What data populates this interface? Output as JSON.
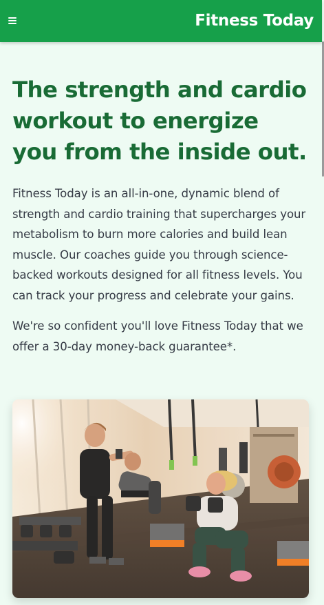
{
  "header": {
    "brand": "Fitness Today",
    "menu_icon": "hamburger-menu-icon",
    "bg_color": "#16a04a"
  },
  "hero": {
    "title": "The strength and cardio workout to energize you from the inside out.",
    "body": "Fitness Today is an all-in-one, dynamic blend of strength and cardio training that supercharges your metabolism to burn more calories and build lean muscle. Our coaches guide you through science-backed workouts designed for all fitness levels. You can track your progress and celebrate your gains.",
    "guarantee": "We're so confident you'll love Fitness Today that we offer a 30-day money-back guarantee*."
  },
  "colors": {
    "page_bg": "#eefbf3",
    "title": "#196b35",
    "body_text": "#353a45"
  }
}
